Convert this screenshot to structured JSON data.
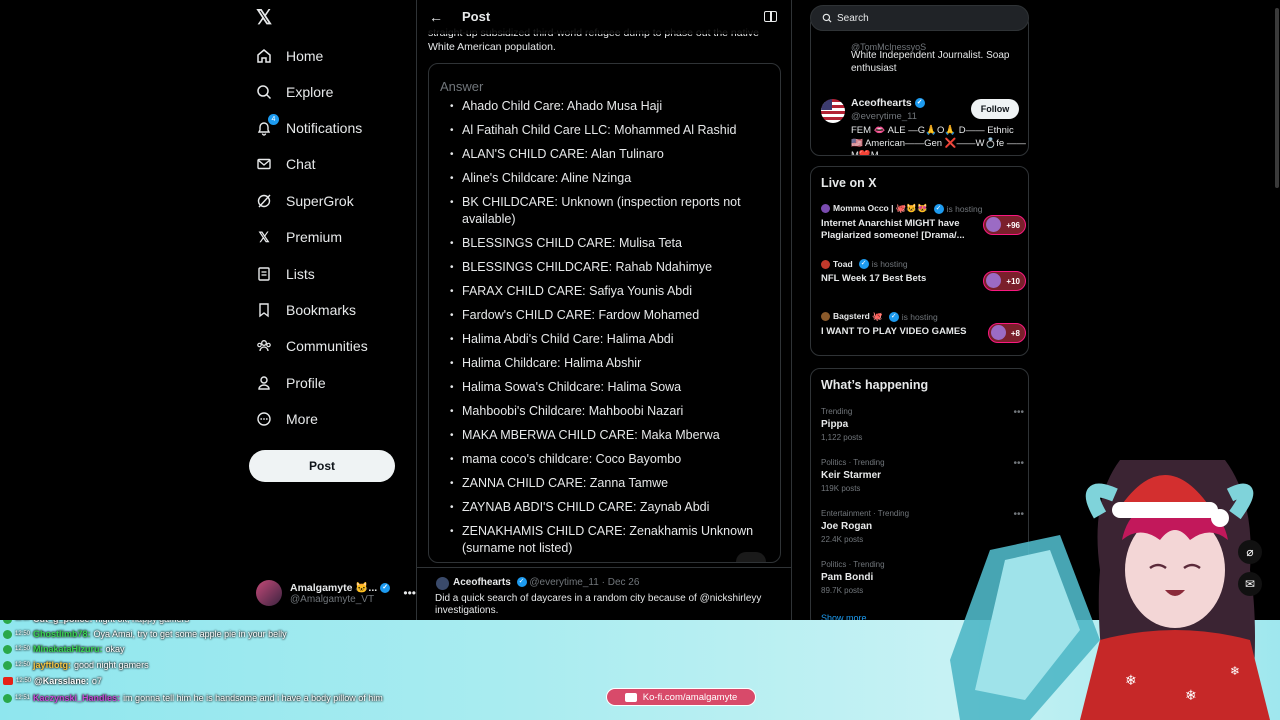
{
  "nav": {
    "items": [
      {
        "label": "Home",
        "icon": "home-icon"
      },
      {
        "label": "Explore",
        "icon": "search-icon"
      },
      {
        "label": "Notifications",
        "icon": "bell-icon",
        "badge": "4"
      },
      {
        "label": "Chat",
        "icon": "mail-icon"
      },
      {
        "label": "SuperGrok",
        "icon": "grok-icon"
      },
      {
        "label": "Premium",
        "icon": "x-icon"
      },
      {
        "label": "Lists",
        "icon": "list-icon"
      },
      {
        "label": "Bookmarks",
        "icon": "bookmark-icon"
      },
      {
        "label": "Communities",
        "icon": "communities-icon"
      },
      {
        "label": "Profile",
        "icon": "person-icon"
      },
      {
        "label": "More",
        "icon": "more-circle-icon"
      }
    ],
    "post_label": "Post",
    "account": {
      "name": "Amalgamyte 🐱...",
      "handle": "@Amalgamyte_VT"
    }
  },
  "main": {
    "header_title": "Post",
    "tweet_snippet": "straight-up subsidized third-world refugee dump to phase out the native White American population.",
    "answer_label": "Answer",
    "answers": [
      "Ahado Child Care: Ahado Musa Haji",
      "Al Fatihah Child Care LLC: Mohammed Al Rashid",
      "ALAN'S CHILD CARE: Alan Tulinaro",
      "Aline's Childcare: Aline Nzinga",
      "BK CHILDCARE: Unknown (inspection reports not available)",
      "BLESSINGS CHILD CARE: Mulisa Teta",
      "BLESSINGS CHILDCARE: Rahab Ndahimye",
      "FARAX CHILD CARE: Safiya Younis Abdi",
      "Fardow's CHILD CARE: Fardow Mohamed",
      "Halima Abdi's Child Care: Halima Abdi",
      "Halima Childcare: Halima Abshir",
      "Halima Sowa's Childcare: Halima Sowa",
      "Mahboobi's Childcare: Mahboobi Nazari",
      "MAKA MBERWA CHILD CARE: Maka Mberwa",
      "mama coco's childcare: Coco Bayombo",
      "ZANNA CHILD CARE: Zanna Tamwe",
      "ZAYNAB ABDI'S CHILD CARE: Zaynab Abdi",
      "ZENAKHAMIS CHILD CARE: Zenakhamis Unknown (surname not listed)"
    ],
    "reply": {
      "name": "Aceofhearts",
      "handle": "@everytime_11",
      "date": "Dec 26",
      "text": "Did a quick search of daycares in a random city because of @nickshirleyy investigations."
    }
  },
  "right": {
    "search_placeholder": "Search",
    "wtf_cut_handle": "@TomMcInessyoS",
    "wtf_top_bio": "White Independent Journalist. Soap enthusiast",
    "wtf_user": {
      "name": "Aceofhearts",
      "handle": "@everytime_11",
      "follow_label": "Follow",
      "bio": "FEM 👄 ALE —G🙏O🙏 D—— Ethnic 🇺🇸 American——Gen ❌——W💍fe ——M❤️M——"
    },
    "live_title": "Live on X",
    "live": [
      {
        "host": "Momma Occo | 🐙😺😻",
        "hosting": "is hosting",
        "title": "Internet Anarchist MIGHT have Plagiarized someone! [Drama/...",
        "count": "+96"
      },
      {
        "host": "Toad",
        "hosting": "is hosting",
        "title": "NFL Week 17 Best Bets",
        "count": "+10"
      },
      {
        "host": "Bagsterd 🐙",
        "hosting": "is hosting",
        "title": "I WANT TO PLAY VIDEO GAMES",
        "count": "+8"
      }
    ],
    "happening_title": "What’s happening",
    "trends": [
      {
        "meta": "Trending",
        "name": "Pippa",
        "count": "1,122 posts"
      },
      {
        "meta": "Politics · Trending",
        "name": "Keir Starmer",
        "count": "119K posts"
      },
      {
        "meta": "Entertainment · Trending",
        "name": "Joe Rogan",
        "count": "22.4K posts"
      },
      {
        "meta": "Politics · Trending",
        "name": "Pam Bondi",
        "count": "89.7K posts"
      }
    ],
    "show_more": "Show more"
  },
  "overlay": {
    "chat": [
      {
        "time": "12:50",
        "user": "Cut_g_police:",
        "msg": "night ok, happy gamers",
        "color": "#e6e6e6",
        "src": "badge"
      },
      {
        "time": "12:50",
        "user": "Ghostlimb78:",
        "msg": "Oya Amai, try to get some apple pie in your belly",
        "color": "#39d353",
        "src": "badge"
      },
      {
        "time": "12:50",
        "user": "MinakataHizuru:",
        "msg": "okay",
        "color": "#39d353",
        "src": "badge"
      },
      {
        "time": "12:50",
        "user": "jayftlotg:",
        "msg": "good night gamers",
        "color": "#f5c542",
        "src": "badge"
      },
      {
        "time": "12:50",
        "user": "@Karsslane:",
        "msg": "o7",
        "color": "#ffffff",
        "src": "youtube"
      },
      {
        "time": "12:51",
        "user": "Kaczynski_Handles:",
        "msg": "im gonna tell him he is handsome and i have a body pillow of him",
        "color": "#c24bd6",
        "src": "badge"
      }
    ],
    "kofi": "Ko-fi.com/amalgamyte"
  }
}
